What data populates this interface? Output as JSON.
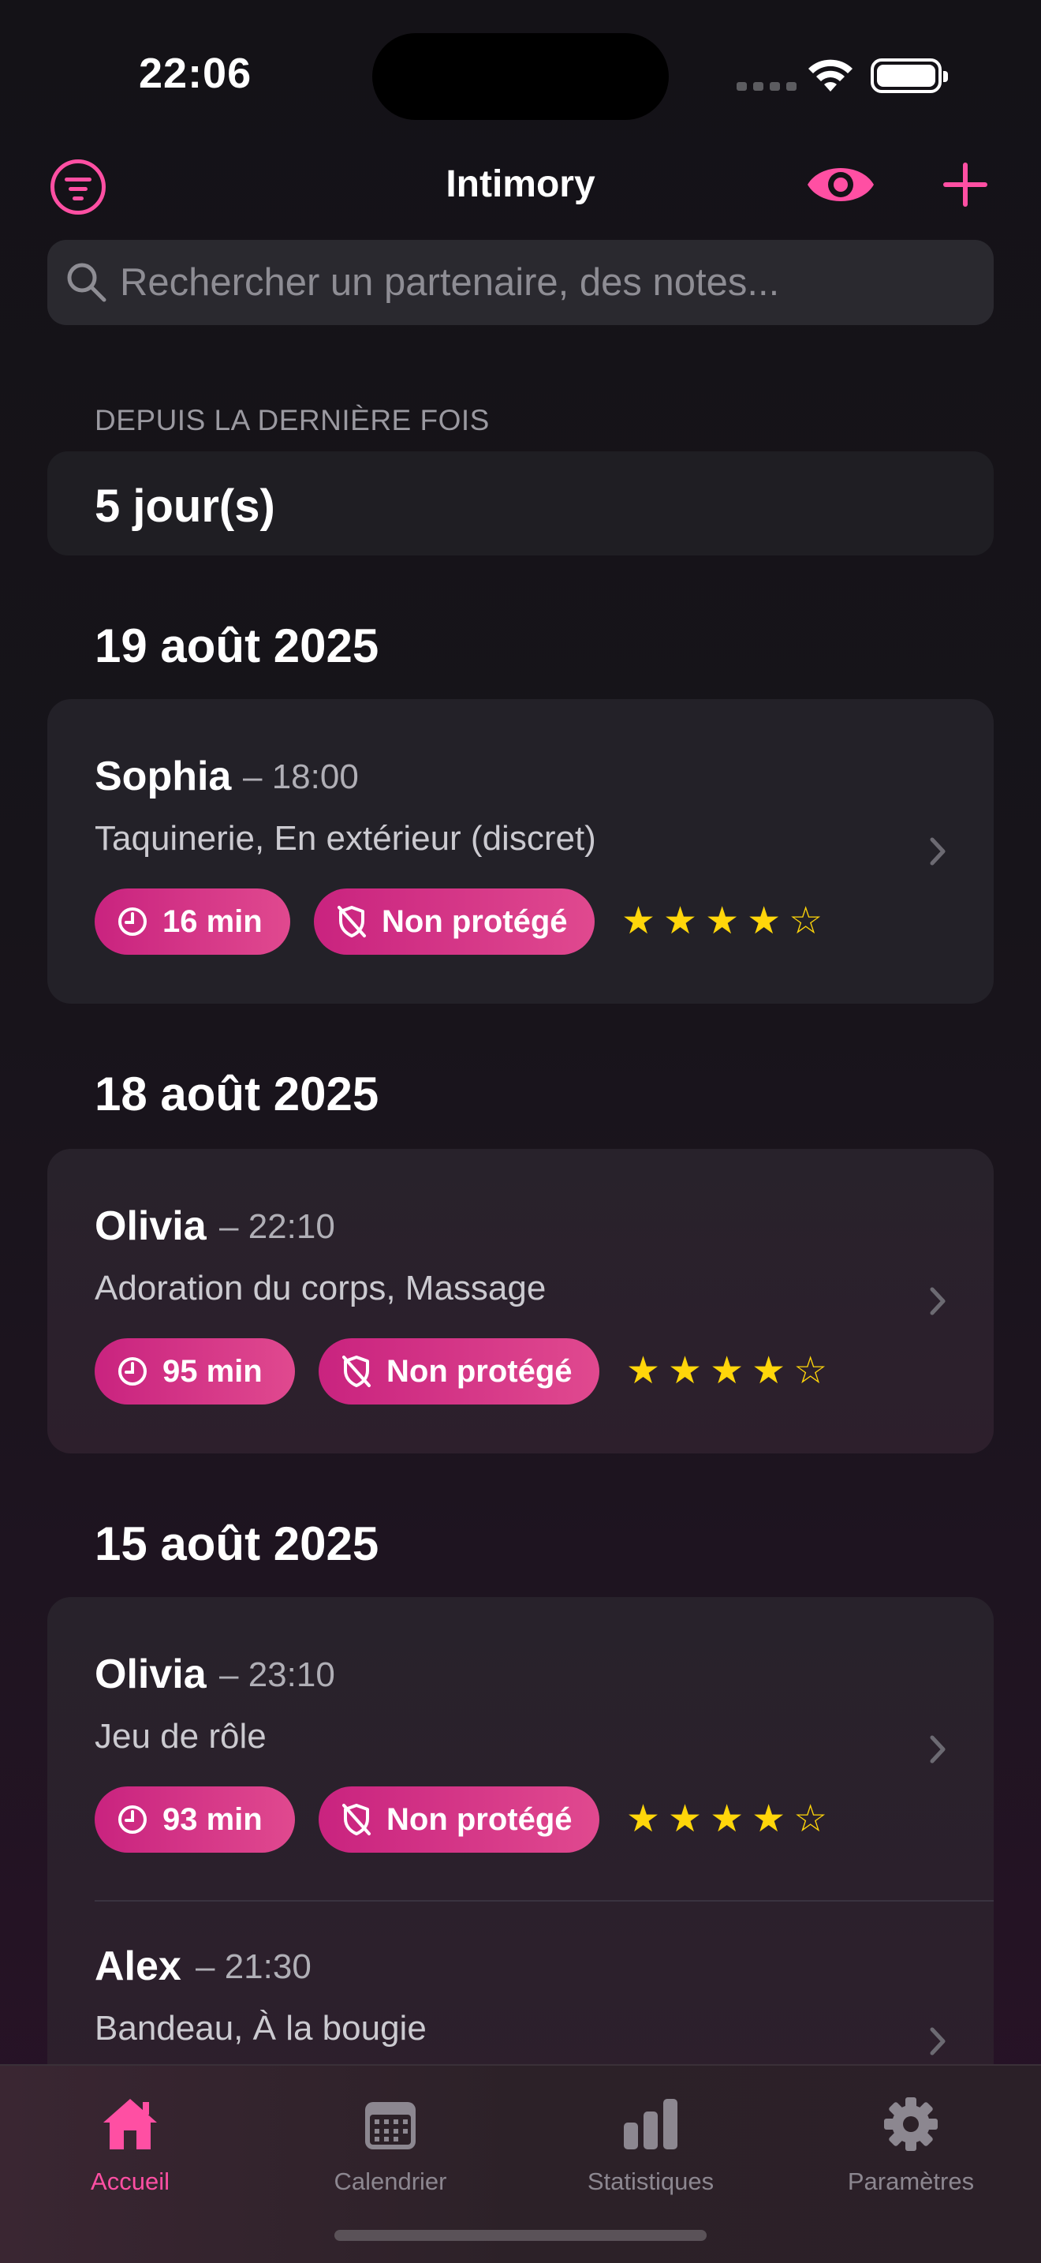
{
  "status_bar": {
    "time": "22:06"
  },
  "nav": {
    "title": "Intimory"
  },
  "search": {
    "placeholder": "Rechercher un partenaire, des notes..."
  },
  "since_last": {
    "caption": "DEPUIS LA DERNIÈRE FOIS",
    "value": "5 jour(s)"
  },
  "sections": [
    {
      "date": "19 août 2025",
      "entries": [
        {
          "name": "Sophia",
          "time": "– 18:00",
          "tags": "Taquinerie, En extérieur (discret)",
          "duration": "16 min",
          "protection": "Non protégé",
          "rating": 4,
          "max_rating": 5
        }
      ]
    },
    {
      "date": "18 août 2025",
      "entries": [
        {
          "name": "Olivia",
          "time": "– 22:10",
          "tags": "Adoration du corps, Massage",
          "duration": "95 min",
          "protection": "Non protégé",
          "rating": 4,
          "max_rating": 5
        }
      ]
    },
    {
      "date": "15 août 2025",
      "entries": [
        {
          "name": "Olivia",
          "time": "– 23:10",
          "tags": "Jeu de rôle",
          "duration": "93 min",
          "protection": "Non protégé",
          "rating": 4,
          "max_rating": 5
        },
        {
          "name": "Alex",
          "time": "– 21:30",
          "tags": "Bandeau, À la bougie"
        }
      ]
    }
  ],
  "tabs": [
    {
      "label": "Accueil",
      "icon": "house-icon",
      "active": true
    },
    {
      "label": "Calendrier",
      "icon": "calendar-icon",
      "active": false
    },
    {
      "label": "Statistiques",
      "icon": "chart-bars-icon",
      "active": false
    },
    {
      "label": "Paramètres",
      "icon": "gear-icon",
      "active": false
    }
  ],
  "colors": {
    "accent": "#ff4fa3",
    "pill": "#d6358a",
    "star": "#ffd60a",
    "background": "#141217",
    "card": "#232128"
  }
}
